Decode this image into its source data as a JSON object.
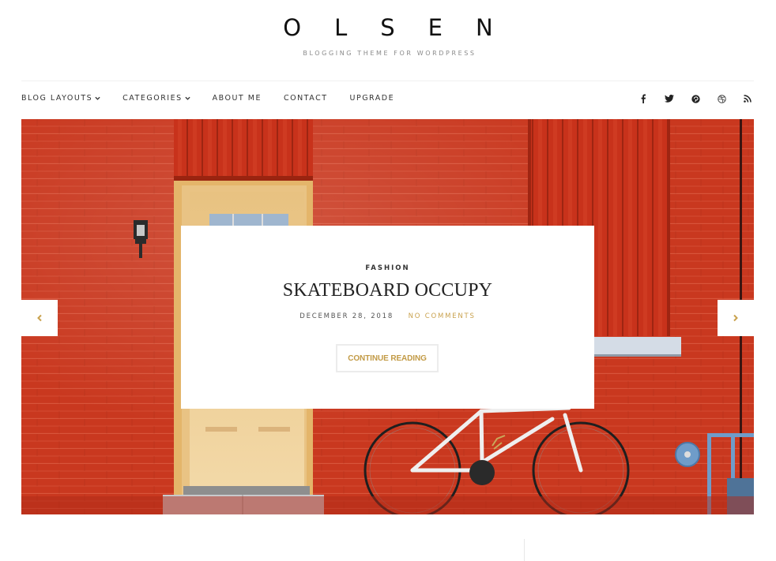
{
  "header": {
    "site_title": "OLSEN",
    "site_description": "BLOGGING THEME FOR WORDPRESS"
  },
  "nav": {
    "items": [
      {
        "label": "BLOG LAYOUTS",
        "has_dropdown": true
      },
      {
        "label": "CATEGORIES",
        "has_dropdown": true
      },
      {
        "label": "ABOUT ME",
        "has_dropdown": false
      },
      {
        "label": "CONTACT",
        "has_dropdown": false
      },
      {
        "label": "UPGRADE",
        "has_dropdown": false
      }
    ],
    "social": [
      {
        "name": "facebook-icon"
      },
      {
        "name": "twitter-icon"
      },
      {
        "name": "pinterest-icon"
      },
      {
        "name": "dribbble-icon"
      },
      {
        "name": "rss-icon"
      }
    ]
  },
  "slider": {
    "image_alt": "Red brick wall with cream door and white bicycle",
    "category": "FASHION",
    "title": "SKATEBOARD OCCUPY",
    "date": "DECEMBER 28, 2018",
    "comments": "NO COMMENTS",
    "button_label": "CONTINUE READING",
    "prev_icon": "chevron-left-icon",
    "next_icon": "chevron-right-icon"
  },
  "colors": {
    "accent": "#c9a24e",
    "brick": "#c7361f",
    "text": "#222222"
  }
}
